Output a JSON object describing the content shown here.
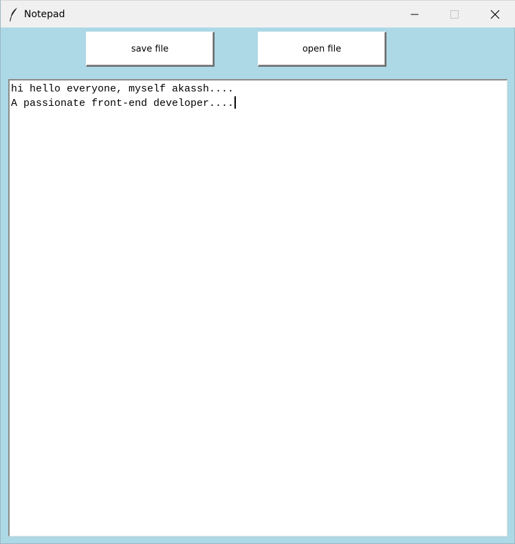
{
  "window": {
    "title": "Notepad",
    "icon": "feather-icon",
    "controls": {
      "minimize_icon": "minimize-icon",
      "maximize_icon": "maximize-icon",
      "close_icon": "close-icon"
    },
    "background_color": "#add8e6"
  },
  "toolbar": {
    "save_label": "save file",
    "open_label": "open file"
  },
  "editor": {
    "lines": [
      "hi hello everyone, myself akassh....",
      "A passionate front-end developer...."
    ]
  }
}
